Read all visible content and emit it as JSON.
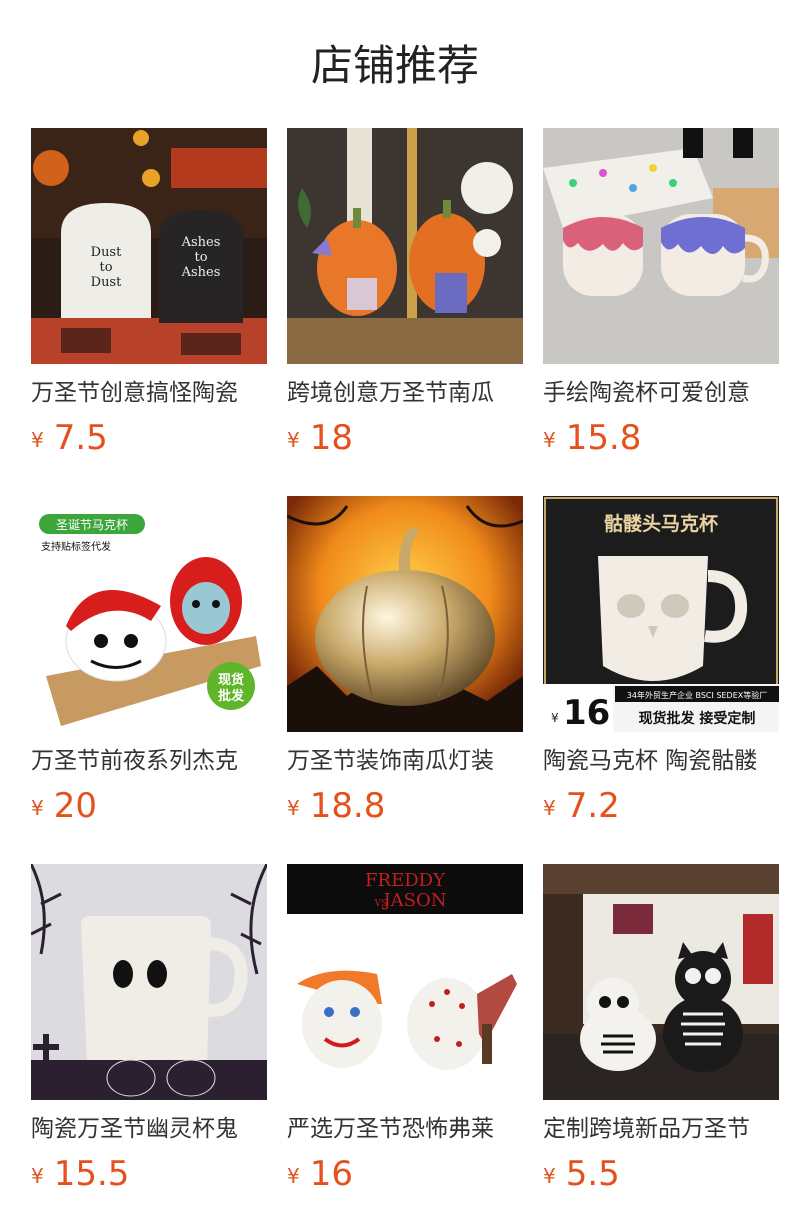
{
  "header": {
    "title": "店铺推荐"
  },
  "currency_symbol": "¥",
  "colors": {
    "price": "#e5511d",
    "text": "#333333"
  },
  "products": [
    {
      "name": "万圣节创意搞怪陶瓷",
      "price": "7.5",
      "image_text": [
        "Dust",
        "to",
        "Dust",
        "Ashes",
        "to",
        "Ashes"
      ]
    },
    {
      "name": "跨境创意万圣节南瓜",
      "price": "18",
      "image_text": []
    },
    {
      "name": "手绘陶瓷杯可爱创意",
      "price": "15.8",
      "image_text": []
    },
    {
      "name": "万圣节前夜系列杰克",
      "price": "20",
      "image_text": [
        "圣诞节马克杯",
        "支持贴标签代发",
        "现货",
        "批发"
      ]
    },
    {
      "name": "万圣节装饰南瓜灯装",
      "price": "18.8",
      "image_text": []
    },
    {
      "name": "陶瓷马克杯 陶瓷骷髅",
      "price": "7.2",
      "image_text": [
        "骷髅头马克杯",
        "¥",
        "16",
        "34年外贸生产企业 BSCI SEDEX等验厂",
        "现货批发 接受定制"
      ]
    },
    {
      "name": "陶瓷万圣节幽灵杯鬼",
      "price": "15.5",
      "image_text": []
    },
    {
      "name": "严选万圣节恐怖弗莱",
      "price": "16",
      "image_text": [
        "FREDDY",
        "VS",
        "JASON"
      ]
    },
    {
      "name": "定制跨境新品万圣节",
      "price": "5.5",
      "image_text": []
    }
  ]
}
